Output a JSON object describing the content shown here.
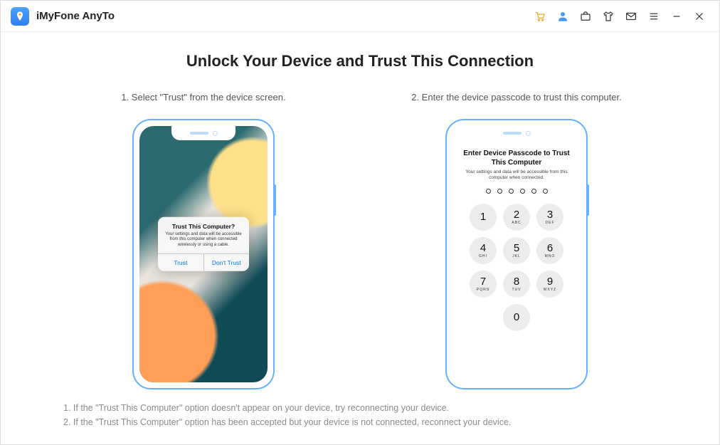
{
  "app": {
    "title": "iMyFone AnyTo"
  },
  "page": {
    "title": "Unlock Your Device and Trust This Connection",
    "step1": "1. Select \"Trust\" from the device screen.",
    "step2": "2. Enter the device passcode to trust this computer."
  },
  "dialog": {
    "title": "Trust This Computer?",
    "body": "Your settings and data will be accessible from this computer when connected wirelessly or using a cable.",
    "trust": "Trust",
    "dont_trust": "Don't Trust"
  },
  "passcode": {
    "title": "Enter Device Passcode to Trust This Computer",
    "sub": "Your settings and data will be accessible from this computer when connected.",
    "keys": [
      {
        "n": "1",
        "l": ""
      },
      {
        "n": "2",
        "l": "ABC"
      },
      {
        "n": "3",
        "l": "DEF"
      },
      {
        "n": "4",
        "l": "GHI"
      },
      {
        "n": "5",
        "l": "JKL"
      },
      {
        "n": "6",
        "l": "MNO"
      },
      {
        "n": "7",
        "l": "PQRS"
      },
      {
        "n": "8",
        "l": "TUV"
      },
      {
        "n": "9",
        "l": "WXYZ"
      }
    ],
    "zero": {
      "n": "0",
      "l": ""
    }
  },
  "tips": {
    "t1": "1. If the \"Trust This Computer\" option doesn't appear on your device, try reconnecting your device.",
    "t2": "2. If the \"Trust This Computer\" option has been accepted but your device is not connected, reconnect your device."
  }
}
